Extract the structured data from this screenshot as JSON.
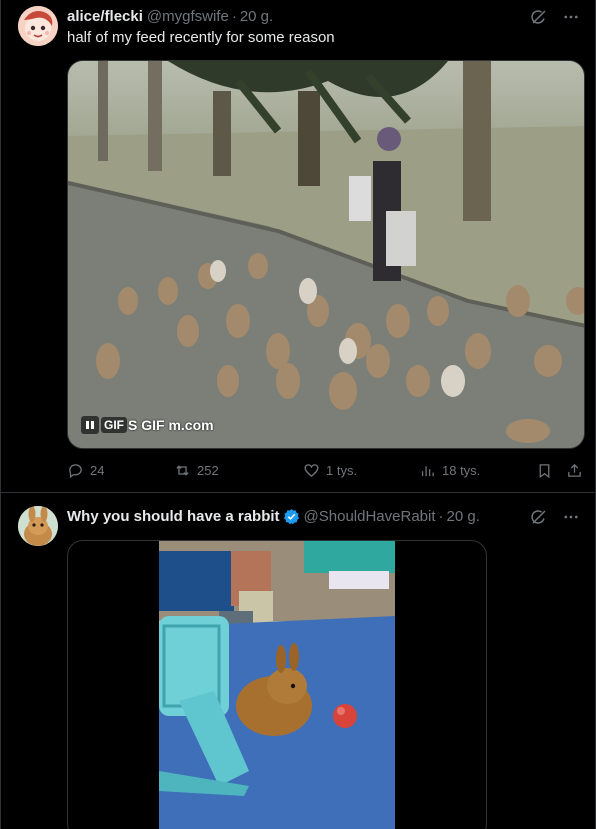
{
  "tweets": [
    {
      "name": "alice/flecki",
      "handle": "@mygfswife",
      "separator": "·",
      "time": "20 g.",
      "text": "half of my feed recently for some reason",
      "media": {
        "pause_label": "II",
        "gif_label": "GIF",
        "watermark": "S GIF m.com"
      },
      "stats": {
        "replies": "24",
        "reposts": "252",
        "likes": "1 tys.",
        "views": "18 tys."
      }
    },
    {
      "name": "Why you should have a rabbit",
      "handle": "@ShouldHaveRabit",
      "separator": "·",
      "time": "20 g."
    }
  ],
  "colors": {
    "verified": "#1d9bf0",
    "muted": "#71767b",
    "border": "#2f3336"
  },
  "icons": [
    "grok-icon",
    "more-icon",
    "reply-icon",
    "repost-icon",
    "like-icon",
    "views-icon",
    "bookmark-icon",
    "share-icon",
    "verified-badge-icon"
  ]
}
